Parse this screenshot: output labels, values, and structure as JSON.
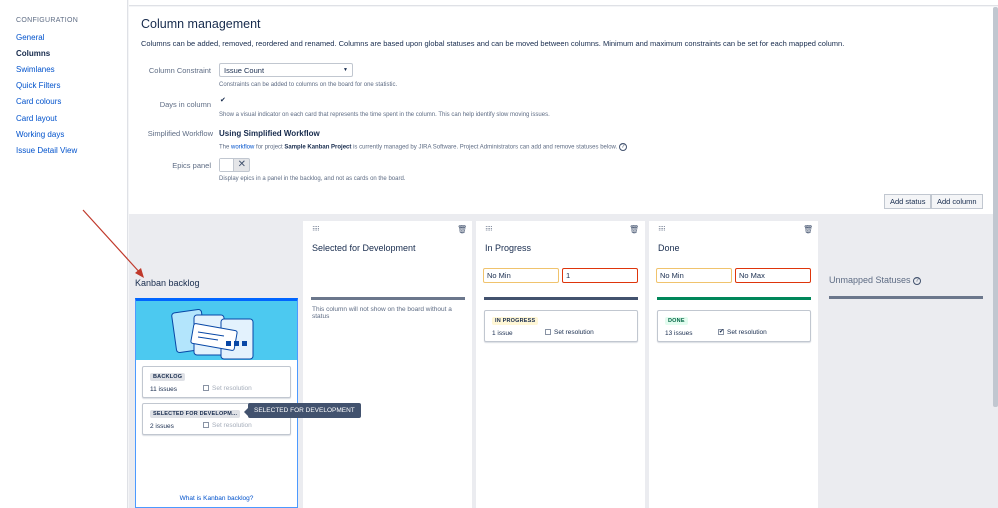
{
  "sidebar": {
    "header": "CONFIGURATION",
    "items": [
      {
        "label": "General",
        "active": false
      },
      {
        "label": "Columns",
        "active": true
      },
      {
        "label": "Swimlanes",
        "active": false
      },
      {
        "label": "Quick Filters",
        "active": false
      },
      {
        "label": "Card colours",
        "active": false
      },
      {
        "label": "Card layout",
        "active": false
      },
      {
        "label": "Working days",
        "active": false
      },
      {
        "label": "Issue Detail View",
        "active": false
      }
    ]
  },
  "main": {
    "title": "Column management",
    "description": "Columns can be added, removed, reordered and renamed. Columns are based upon global statuses and can be moved between columns. Minimum and maximum constraints can be set for each mapped column.",
    "column_constraint": {
      "label": "Column Constraint",
      "value": "Issue Count",
      "help": "Constraints can be added to columns on the board for one statistic."
    },
    "days_in_column": {
      "label": "Days in column",
      "checked": true,
      "help": "Show a visual indicator on each card that represents the time spent in the column. This can help identify slow moving issues."
    },
    "simplified_workflow": {
      "label": "Simplified Workflow",
      "value": "Using Simplified Workflow",
      "help_pre": "The ",
      "help_link": "workflow",
      "help_mid": " for project ",
      "help_project": "Sample Kanban Project",
      "help_post": " is currently managed by JIRA Software. Project Administrators can add and remove statuses below."
    },
    "epics_panel": {
      "label": "Epics panel",
      "enabled": false,
      "help": "Display epics in a panel in the backlog, and not as cards on the board."
    },
    "buttons": {
      "add_status": "Add status",
      "add_column": "Add column"
    }
  },
  "board": {
    "backlog": {
      "name": "Kanban backlog",
      "cards": [
        {
          "status": "BACKLOG",
          "issues": "11 issues",
          "set_resolution": "Set resolution"
        },
        {
          "status": "SELECTED FOR DEVELOPM...",
          "issues": "2 issues",
          "set_resolution": "Set resolution"
        }
      ],
      "tooltip": "SELECTED FOR DEVELOPMENT",
      "link": "What is Kanban backlog?"
    },
    "columns": [
      {
        "name": "Selected for Development",
        "note": "This column will not show on the board without a status"
      },
      {
        "name": "In Progress",
        "min": "No Min",
        "max": "1",
        "bar_color": "#42526e",
        "card": {
          "status": "IN PROGRESS",
          "issues": "1 issue",
          "set_resolution": "Set resolution",
          "checked": false,
          "lozenge_bg": "#fff7d6",
          "lozenge_color": "#172b4d"
        }
      },
      {
        "name": "Done",
        "min": "No Min",
        "max": "No Max",
        "bar_color": "#00875a",
        "card": {
          "status": "DONE",
          "issues": "13 issues",
          "set_resolution": "Set resolution",
          "checked": true,
          "lozenge_bg": "#e3fcef",
          "lozenge_color": "#006644"
        }
      }
    ],
    "unmapped": {
      "name": "Unmapped Statuses"
    }
  },
  "annotation": {
    "color": "#c0392b"
  },
  "colors": {
    "link": "#0052cc",
    "text": "#172b4d",
    "board_bg": "#ebecf0"
  }
}
